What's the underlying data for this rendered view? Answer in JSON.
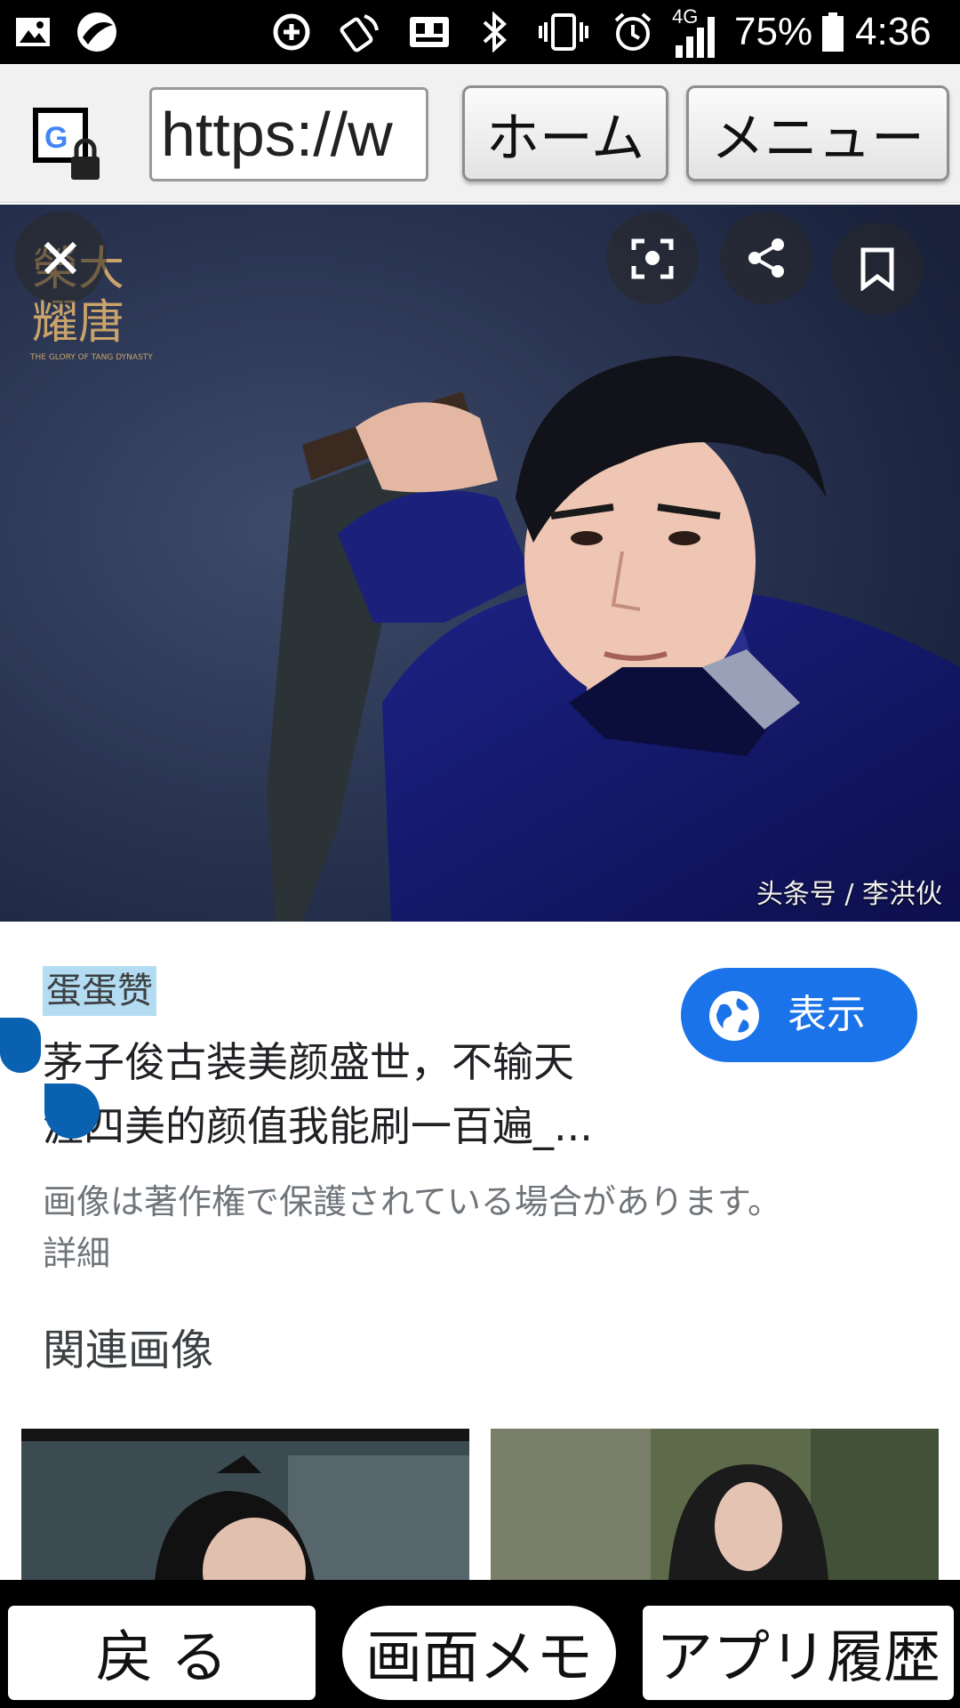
{
  "status_bar": {
    "network": "4G",
    "battery": "75%",
    "time": "4:36"
  },
  "browser": {
    "url": "https://w",
    "home_label": "ホーム",
    "menu_label": "メニュー"
  },
  "hero": {
    "watermark_text": "大唐榮耀",
    "credit": "头条号 / 李洪伙"
  },
  "result": {
    "source": "蛋蛋赞",
    "title_line1": "茅子俊古装美颜盛世，不输天",
    "title_line2": "涯四美的颜值我能刷一百遍_...",
    "visit_label": "表示",
    "copyright_line1": "画像は著作権で保護されている場合があります。",
    "copyright_line2": "詳細",
    "related_title": "関連画像"
  },
  "bottom_nav": {
    "back_label": "戻 る",
    "memo_label": "画面メモ",
    "apps_label": "アプリ履歴"
  },
  "colors": {
    "accent": "#1a73e8",
    "highlight": "#b3dbf1",
    "selection_handle": "#0a61b0"
  }
}
